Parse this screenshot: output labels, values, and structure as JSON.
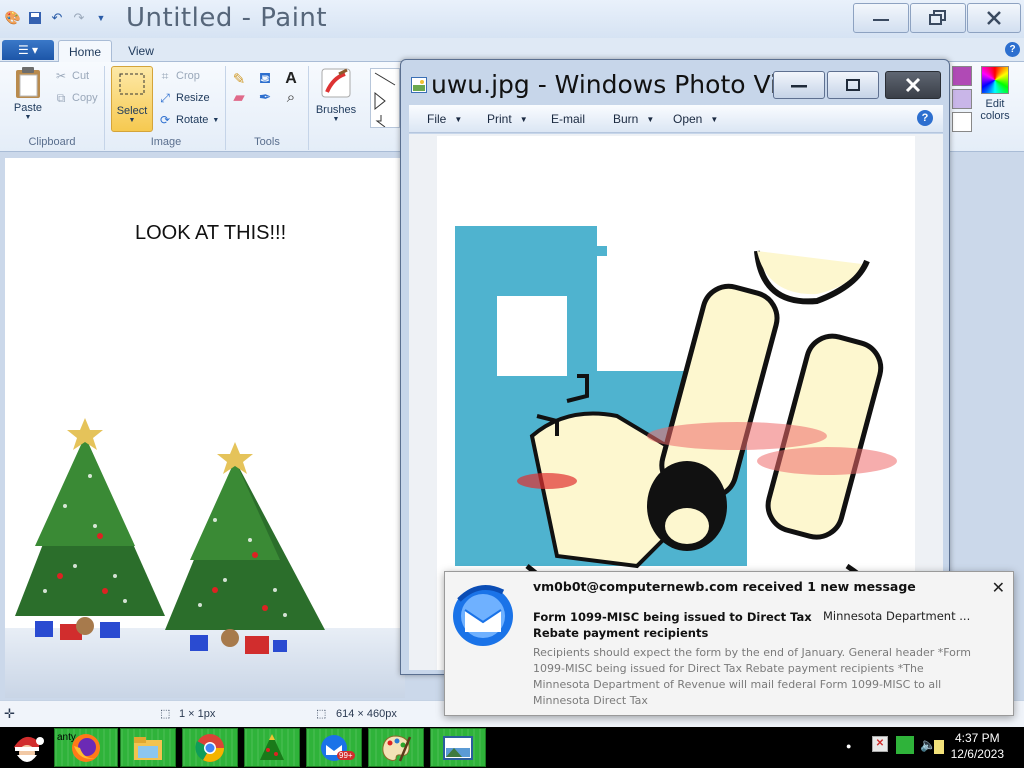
{
  "paint": {
    "title": "Untitled - Paint",
    "tabs": {
      "home": "Home",
      "view": "View"
    },
    "clipboard": {
      "paste": "Paste",
      "cut": "Cut",
      "copy": "Copy",
      "group": "Clipboard"
    },
    "image": {
      "select": "Select",
      "crop": "Crop",
      "resize": "Resize",
      "rotate": "Rotate",
      "group": "Image"
    },
    "tools": {
      "group": "Tools"
    },
    "brushes": "Brushes",
    "edit_colors": "Edit colors",
    "canvas_text": "LOOK AT THIS!!!",
    "status": {
      "selection_size": "1 × 1px",
      "canvas_size": "614 × 460px"
    }
  },
  "viewer": {
    "title": "uwu.jpg - Windows Photo Vi...",
    "menu": {
      "file": "File",
      "print": "Print",
      "email": "E-mail",
      "burn": "Burn",
      "open": "Open"
    }
  },
  "notification": {
    "header": "vm0b0t@computernewb.com received 1 new message",
    "subject": "Form 1099-MISC being issued to Direct Tax Rebate payment recipients",
    "sender": "Minnesota Department ...",
    "body": "Recipients should expect the form by the end of January. General header *Form 1099-MISC being issued for Direct Tax Rebate payment recipients *The Minnesota Department of Revenue will mail federal Form 1099-MISC to all Minnesota Direct Tax"
  },
  "taskbar": {
    "partial_label": "anty",
    "badge": "99+",
    "time": "4:37 PM",
    "date": "12/6/2023"
  },
  "colors": {
    "taskbar_item": "#2fb33a",
    "ribbon": "#e4edf8",
    "selected_tool": "#fbd868"
  }
}
